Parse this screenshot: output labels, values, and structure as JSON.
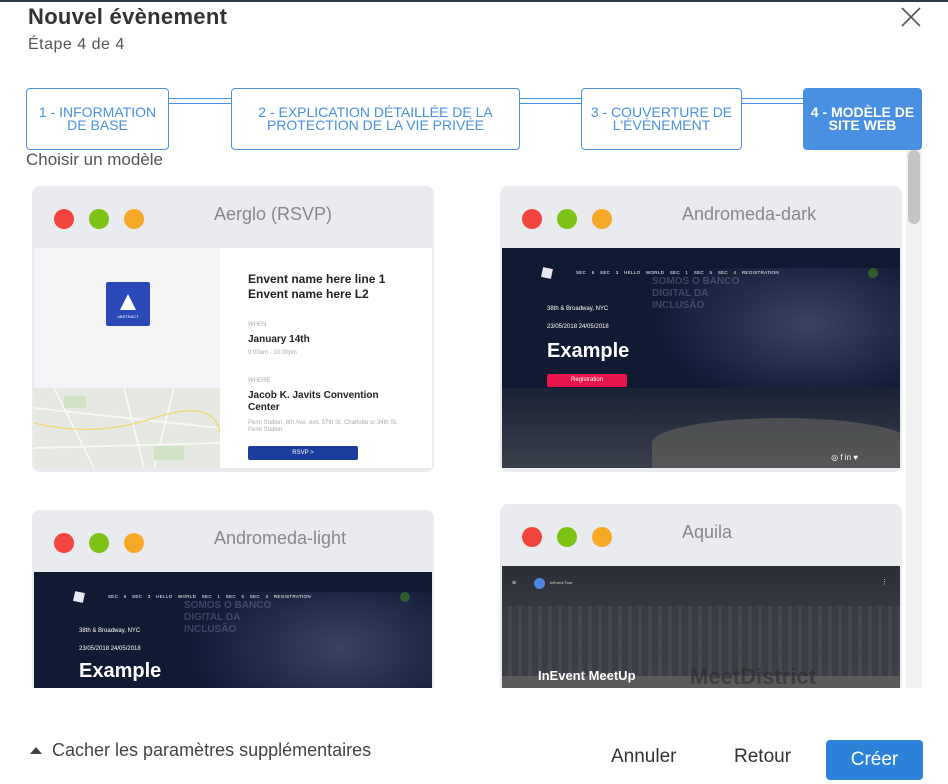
{
  "dialog": {
    "title": "Nouvel évènement",
    "subtitle": "Étape 4 de 4"
  },
  "stepper": {
    "steps": [
      {
        "label": "1 - INFORMATION DE BASE",
        "active": false
      },
      {
        "label": "2 - EXPLICATION DÉTAILLÉE DE LA PROTECTION DE LA VIE PRIVÉE",
        "active": false
      },
      {
        "label": "3 - COUVERTURE DE L'ÉVÉNEMENT",
        "active": false
      },
      {
        "label": "4 - MODÈLE DE SITE WEB",
        "active": true
      }
    ]
  },
  "templates": {
    "label": "Choisir un modèle",
    "items": [
      {
        "name": "Aerglo (RSVP)",
        "preview": {
          "logo_text": "ABSTRACT",
          "title": "Envent name here line 1 Envent name here L2",
          "when_label": "WHEN",
          "date": "January 14th",
          "time": "9:00am - 10:00pm",
          "where_label": "WHERE",
          "venue": "Jacob K. Javits Convention Center",
          "address": "Penn Station, 8th Ave. exit, 37th St. Charlotte or 34th St. Penn Station",
          "button": "RSVP >"
        }
      },
      {
        "name": "Andromeda-dark",
        "preview": {
          "nav": "SEC 6 SEC 3 HELLO WORLD SEC 1 SEC 5 SEC 4 REGISTRATION",
          "background_text": "SOMOS O BANCO DIGITAL DA INCLUSÃO",
          "location": "38th & Broadway, NYC",
          "dates": "23/05/2018   24/05/2018",
          "heading": "Example",
          "button": "Registration",
          "social": "◎ f in ♥"
        }
      },
      {
        "name": "Andromeda-light",
        "preview": {
          "nav": "SEC 6 SEC 3 HELLO WORLD SEC 1 SEC 5 SEC 4 REGISTRATION",
          "background_text": "SOMOS O BANCO DIGITAL DA INCLUSÃO",
          "location": "38th & Broadway, NYC",
          "dates": "23/05/2018   24/05/2018",
          "heading": "Example"
        }
      },
      {
        "name": "Aquila",
        "preview": {
          "menu_icon": "≡",
          "brand": "InEvent Tour",
          "dots": "⋮",
          "title": "InEvent MeetUp",
          "sign": "MeetDistrict"
        }
      }
    ]
  },
  "footer": {
    "toggle_label": "Cacher les paramètres supplémentaires",
    "cancel": "Annuler",
    "back": "Retour",
    "create": "Créer"
  },
  "colors": {
    "primary": "#4a90e2",
    "create_button": "#2b82d8",
    "dot_red": "#f2453d",
    "dot_green": "#7cc316",
    "dot_yellow": "#f6a927"
  },
  "icons": {
    "close": "close-icon",
    "toggle": "caret-up-icon"
  }
}
